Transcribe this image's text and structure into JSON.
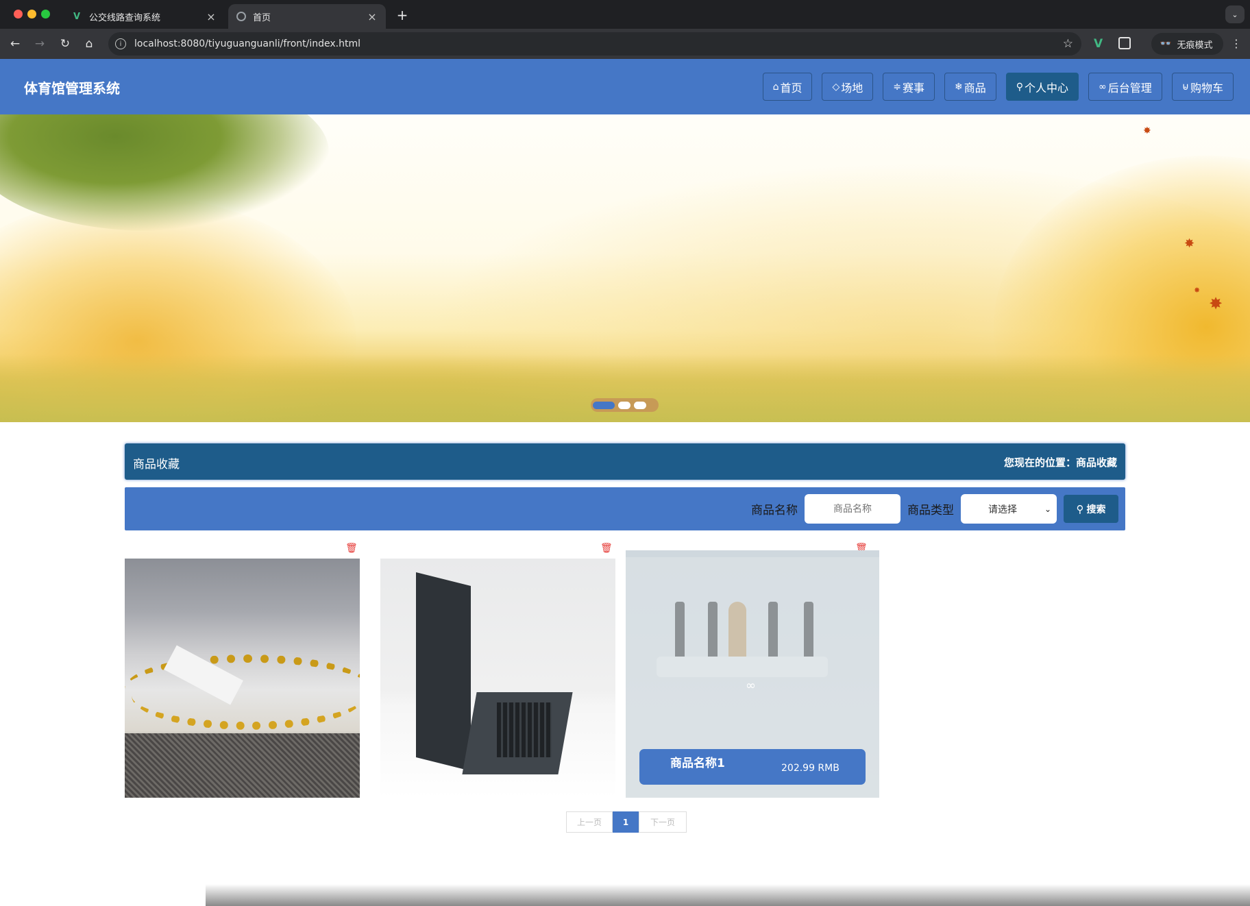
{
  "browser": {
    "tabs": [
      {
        "title": "公交线路查询系统",
        "favicon": "vue-icon",
        "active": false
      },
      {
        "title": "首页",
        "favicon": "globe-icon",
        "active": true
      }
    ],
    "url": "localhost:8080/tiyuguanguanli/front/index.html",
    "incognito_label": "无痕模式"
  },
  "site": {
    "title": "体育馆管理系统",
    "nav": [
      {
        "label": "首页",
        "icon": "home-icon"
      },
      {
        "label": "场地",
        "icon": "tag-icon"
      },
      {
        "label": "赛事",
        "icon": "sliders-icon"
      },
      {
        "label": "商品",
        "icon": "snowflake-icon"
      },
      {
        "label": "个人中心",
        "icon": "user-icon",
        "active": true
      },
      {
        "label": "后台管理",
        "icon": "link-icon"
      },
      {
        "label": "购物车",
        "icon": "cart-icon"
      }
    ]
  },
  "banner": {
    "slide_count": 3,
    "active_slide": 1
  },
  "section": {
    "title": "商品收藏",
    "breadcrumb": "您现在的位置：商品收藏"
  },
  "search": {
    "name_label": "商品名称",
    "name_placeholder": "商品名称",
    "type_label": "商品类型",
    "type_value": "请选择",
    "button_label": "搜索"
  },
  "products": [
    {
      "image": "gold-chain"
    },
    {
      "image": "laptop"
    },
    {
      "image": "kitchen-rack",
      "hovered": true,
      "name": "商品名称1",
      "price": "202.99 RMB"
    }
  ],
  "pagination": {
    "prev": "上一页",
    "current": "1",
    "next": "下一页"
  },
  "colors": {
    "primary": "#4577c6",
    "dark": "#1e5c8a",
    "delete": "#e53935"
  }
}
